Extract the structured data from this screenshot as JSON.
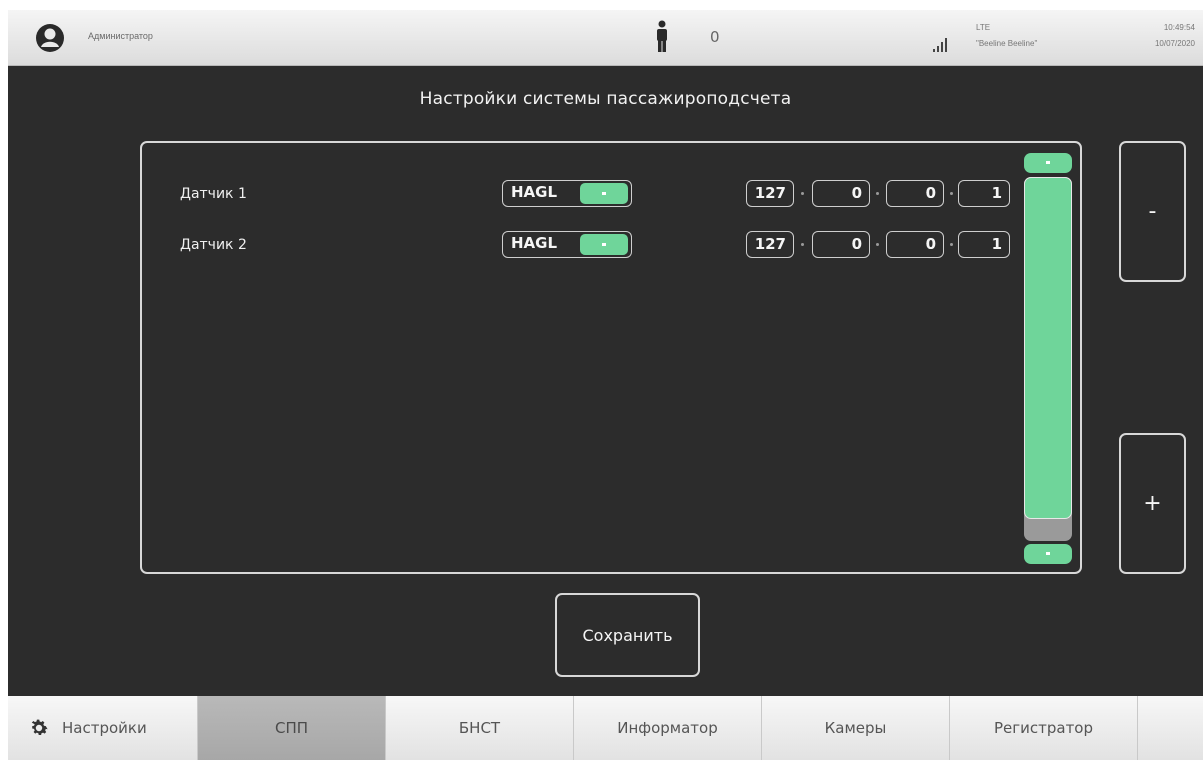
{
  "topbar": {
    "user_name": "Администратор",
    "passenger_count": "0",
    "network_type": "LTE",
    "operator": "\"Beeline Beeline\"",
    "time": "10:49:54",
    "date": "10/07/2020",
    "icons": [
      "user-icon",
      "passenger-icon",
      "signal-icon"
    ]
  },
  "title": "Настройки системы пассажироподсчета",
  "sensors": [
    {
      "label": "Датчик 1",
      "protocol": "HAGL",
      "ip": [
        "127",
        "0",
        "0",
        "1"
      ]
    },
    {
      "label": "Датчик 2",
      "protocol": "HAGL",
      "ip": [
        "127",
        "0",
        "0",
        "1"
      ]
    }
  ],
  "side_buttons": {
    "remove_label": "-",
    "add_label": "+"
  },
  "save_label": "Сохранить",
  "tabs": [
    {
      "label": "Настройки",
      "icon": "gear-icon",
      "active": false
    },
    {
      "label": "СПП",
      "active": true
    },
    {
      "label": "БНСТ",
      "active": false
    },
    {
      "label": "Информатор",
      "active": false
    },
    {
      "label": "Камеры",
      "active": false
    },
    {
      "label": "Регистратор",
      "active": false
    }
  ],
  "colors": {
    "background": "#2c2c2c",
    "accent": "#6fd59a",
    "border": "#d8d8d8",
    "active_tab": "#a9a9a9"
  }
}
